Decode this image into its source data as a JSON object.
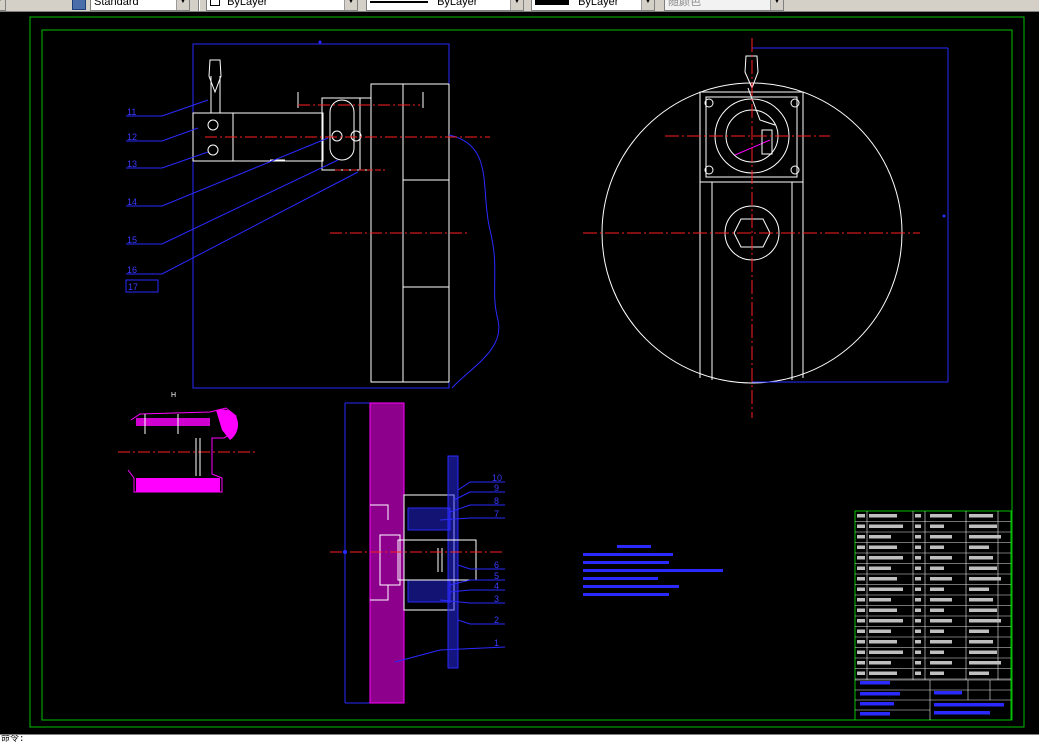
{
  "toolbar": {
    "text_style": "Standard",
    "layer": "ByLayer",
    "linetype": "ByLayer",
    "lineweight": "ByLayer",
    "plot_style": "随颜色"
  },
  "drawing": {
    "leader_labels_top": [
      "11",
      "12",
      "13",
      "14",
      "15",
      "16",
      "17"
    ],
    "leader_labels_bottom": [
      "10",
      "9",
      "8",
      "7",
      "6",
      "5",
      "4",
      "3",
      "2",
      "1"
    ],
    "detail_view_label": "H"
  },
  "cmdline": {
    "prompt": "命令:"
  },
  "colors": {
    "background": "#000000",
    "frame": "#00c000",
    "geometry": "#ffffff",
    "centerline": "#ff2020",
    "dimension": "#2a2aff",
    "hatch": "#ff00ff",
    "toolbar": "#d4d0c8"
  }
}
